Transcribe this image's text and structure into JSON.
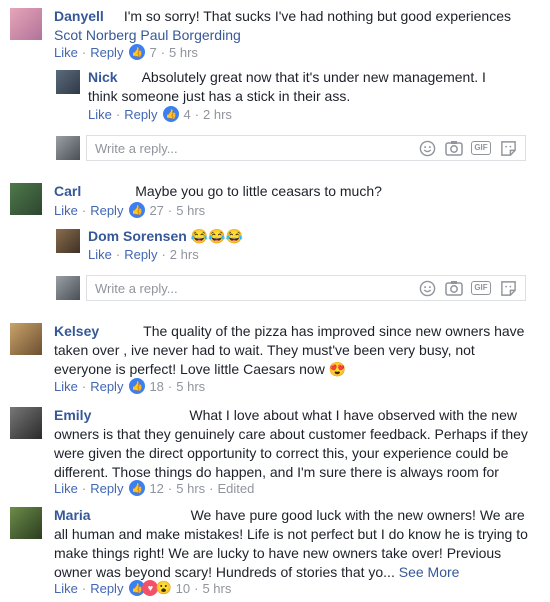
{
  "comments": [
    {
      "name": "Danyell",
      "text_pre": "I'm so sorry! That sucks I've had nothing but good experiences ",
      "tags": "Scot Norberg Paul Borgerding",
      "like": "Like",
      "reply": "Reply",
      "count": "7",
      "time": "5 hrs"
    },
    {
      "name": "Nick",
      "text": "Absolutely great now that it's under new management. I think someone just has a stick in their ass.",
      "like": "Like",
      "reply": "Reply",
      "count": "4",
      "time": "2 hrs"
    },
    {
      "name": "Carl",
      "text": "Maybe you go to little ceasars to much?",
      "like": "Like",
      "reply": "Reply",
      "count": "27",
      "time": "5 hrs"
    },
    {
      "name": "Dom Sorensen",
      "text": "😂😂😂",
      "like": "Like",
      "reply": "Reply",
      "time": "2 hrs"
    },
    {
      "name": "Kelsey",
      "text": "The quality of the pizza has improved since new owners have taken over , ive never had to wait. They must've been very busy, not everyone is perfect! Love little Caesars now 😍",
      "like": "Like",
      "reply": "Reply",
      "count": "18",
      "time": "5 hrs"
    },
    {
      "name": "Emily",
      "text": "What I love about what I have observed with the new owners is that they genuinely care about customer feedback. Perhaps if they were given the direct opportunity to correct this, your experience could be different. Those things do happen, and I'm sure there is always room for improvement 👍",
      "like": "Like",
      "reply": "Reply",
      "count": "12",
      "time": "5 hrs",
      "edited": "Edited"
    },
    {
      "name": "Maria",
      "text": "We have pure good luck with the new owners! We are all human and make mistakes! Life is not perfect but I do know he is trying to make things right! We are lucky to have new owners take over! Previous owner was beyond scary! Hundreds of stories that yo...",
      "see_more": "See More",
      "like": "Like",
      "reply": "Reply",
      "count": "10",
      "time": "5 hrs"
    }
  ],
  "reply_placeholder": "Write a reply...",
  "icons": [
    "smiley-icon",
    "camera-icon",
    "gif-icon",
    "sticker-icon"
  ],
  "gif_label": "GIF",
  "colors": {
    "name": "#365899",
    "link": "#4267b2",
    "meta": "#90949c",
    "like_reaction": "#3b7ff0"
  }
}
